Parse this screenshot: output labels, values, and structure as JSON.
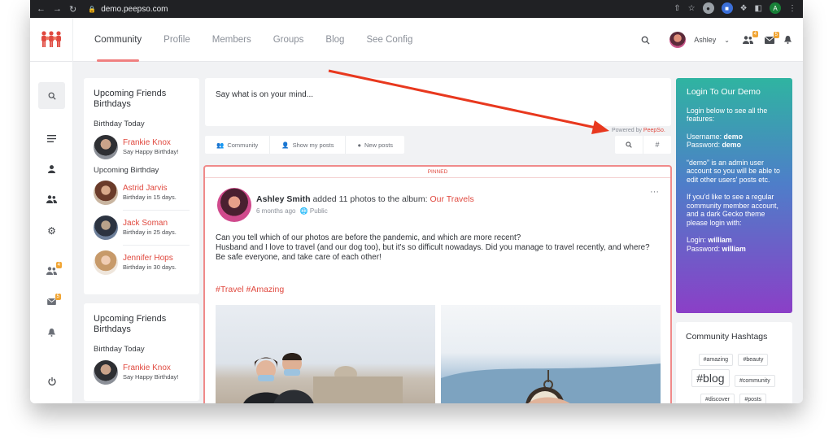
{
  "browser": {
    "url": "demo.peepso.com"
  },
  "header": {
    "nav": [
      "Community",
      "Profile",
      "Members",
      "Groups",
      "Blog",
      "See Config"
    ],
    "user_name": "Ashley",
    "friends_badge": "4",
    "messages_badge": "5"
  },
  "sidebar": {
    "friends_badge": "4",
    "messages_badge": "5"
  },
  "birthdays": {
    "title": "Upcoming Friends Birthdays",
    "today_label": "Birthday Today",
    "today": [
      {
        "name": "Frankie Knox",
        "note": "Say Happy Birthday!"
      }
    ],
    "upcoming_label": "Upcoming Birthday",
    "upcoming": [
      {
        "name": "Astrid Jarvis",
        "note": "Birthday in 15 days."
      },
      {
        "name": "Jack Soman",
        "note": "Birthday in 25 days."
      },
      {
        "name": "Jennifer Hops",
        "note": "Birthday in 30 days."
      }
    ]
  },
  "birthdays2": {
    "title": "Upcoming Friends Birthdays",
    "today_label": "Birthday Today",
    "today": [
      {
        "name": "Frankie Knox",
        "note": "Say Happy Birthday!"
      }
    ]
  },
  "composer": {
    "placeholder": "Say what is on your mind...",
    "powered_prefix": "Powered by",
    "powered_brand": "PeepSo."
  },
  "filters": [
    "Community",
    "Show my posts",
    "New posts"
  ],
  "post": {
    "pinned": "PINNED",
    "author": "Ashley Smith",
    "action": "added 11 photos to the album:",
    "album": "Our Travels",
    "time": "6 months ago",
    "privacy": "Public",
    "more": "···",
    "body": [
      "Can you tell which of our photos are before the pandemic, and which are more recent?",
      "Husband and I love to travel (and our dog too), but it's so difficult nowadays. Did you manage to travel recently, and where?",
      "Be safe everyone, and take care of each other!"
    ],
    "tags": "#Travel #Amazing"
  },
  "login": {
    "title": "Login To Our Demo",
    "intro": "Login below to see all the features:",
    "username_label": "Username:",
    "username": "demo",
    "password_label": "Password:",
    "password": "demo",
    "admin_quote_open": "“",
    "admin_user": "demo",
    "admin_note": "” is an admin user account so you will be able to edit other users' posts etc.",
    "regular_note": "If you'd like to see a regular community member account, and a dark Gecko theme please login with:",
    "login2_label": "Login:",
    "login2": "william",
    "password2_label": "Password:",
    "password2": "william"
  },
  "hashtags": {
    "title": "Community Hashtags",
    "tags": [
      "#amazing",
      "#beauty",
      "#blog",
      "#community",
      "#discover",
      "#posts"
    ]
  },
  "colors": {
    "accent": "#e0493f",
    "arrow": "#e8381e",
    "pinned_border": "#f08a8a"
  }
}
